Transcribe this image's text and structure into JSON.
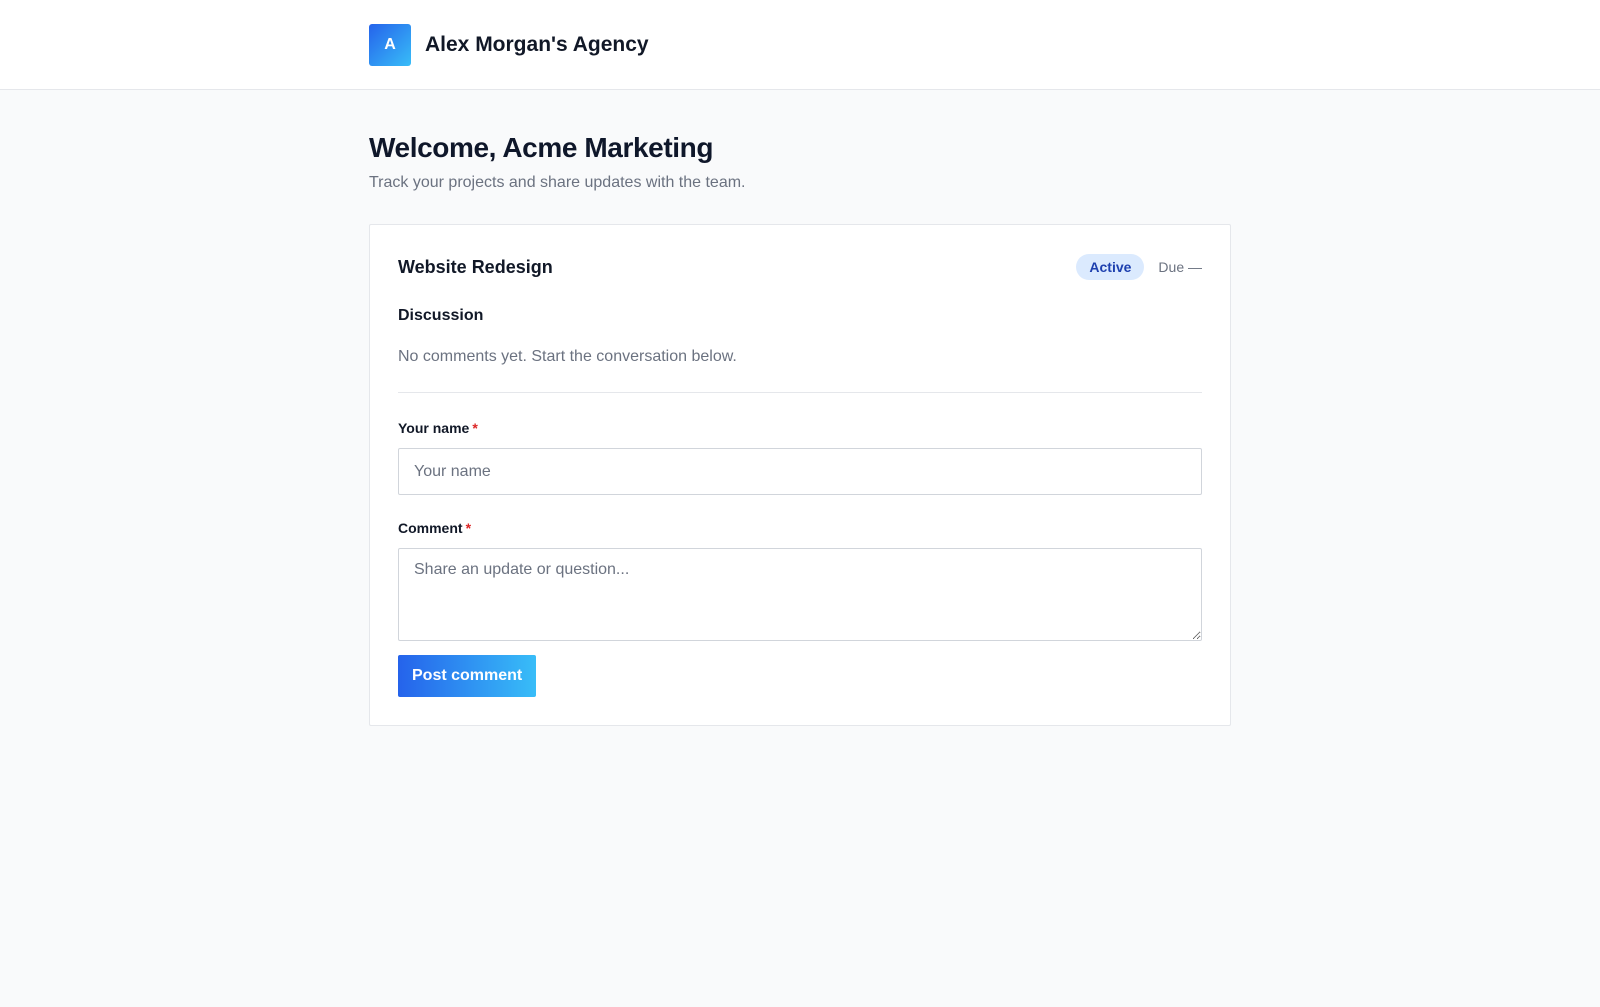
{
  "header": {
    "logo_letter": "A",
    "agency_name": "Alex Morgan's Agency"
  },
  "main": {
    "title": "Welcome, Acme Marketing",
    "subtitle": "Track your projects and share updates with the team."
  },
  "project": {
    "name": "Website Redesign",
    "status": "Active",
    "due": "Due —",
    "discussion_title": "Discussion",
    "empty_message": "No comments yet. Start the conversation below."
  },
  "form": {
    "name_label": "Your name",
    "name_placeholder": "Your name",
    "comment_label": "Comment",
    "comment_placeholder": "Share an update or question...",
    "required_mark": "*",
    "submit_label": "Post comment"
  },
  "colors": {
    "accent": "#2563eb",
    "badge_bg": "#dbeafe",
    "badge_text": "#1e40af",
    "required": "#dc2626"
  }
}
